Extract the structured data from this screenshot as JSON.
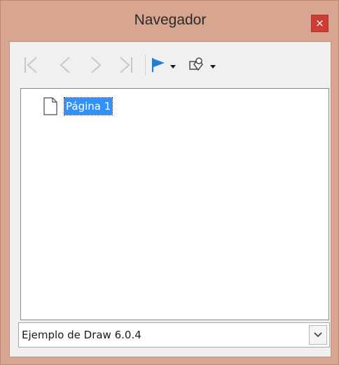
{
  "window": {
    "title": "Navegador",
    "close_label": "×"
  },
  "toolbar": {
    "buttons": [
      {
        "name": "first-page",
        "icon": "first-page-icon",
        "enabled": false
      },
      {
        "name": "previous-page",
        "icon": "previous-page-icon",
        "enabled": false
      },
      {
        "name": "next-page",
        "icon": "next-page-icon",
        "enabled": false
      },
      {
        "name": "last-page",
        "icon": "last-page-icon",
        "enabled": false
      },
      {
        "name": "drag-mode",
        "icon": "flag-icon",
        "enabled": true,
        "has_dropdown": true
      },
      {
        "name": "shapes",
        "icon": "shapes-icon",
        "enabled": true,
        "has_dropdown": true
      }
    ]
  },
  "tree": {
    "items": [
      {
        "label": "Página 1",
        "icon": "page-icon",
        "selected": true
      }
    ]
  },
  "document_select": {
    "value": "Ejemplo de Draw 6.0.4"
  },
  "colors": {
    "frame": "#d8a590",
    "close": "#cc3d33",
    "selection": "#3390ff",
    "flag": "#1f7fd6",
    "disabled_icon": "#c8c8c8"
  }
}
